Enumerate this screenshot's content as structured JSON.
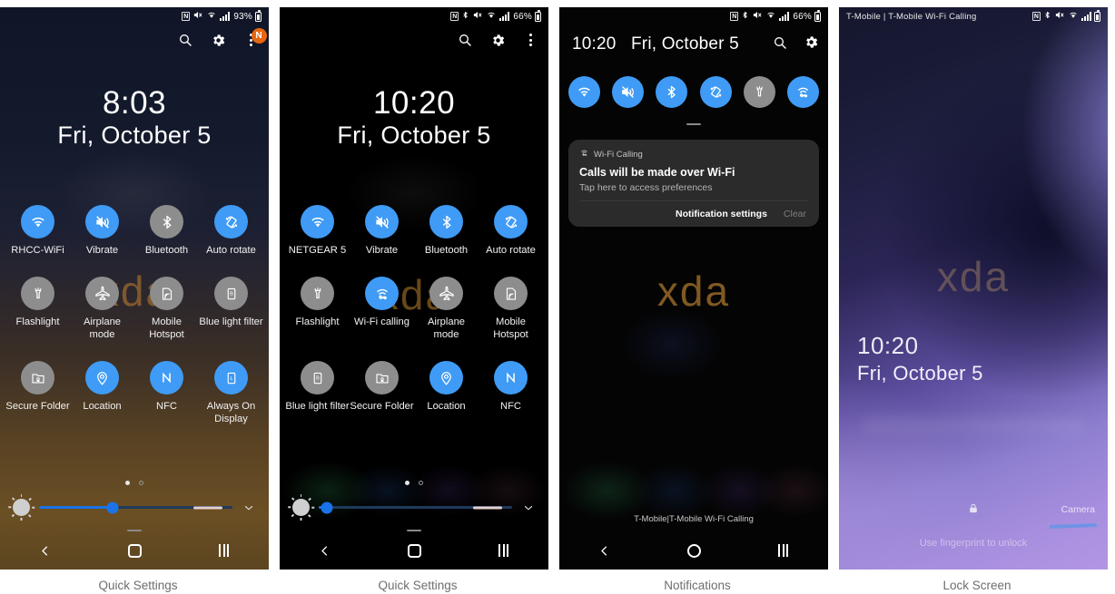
{
  "panels": [
    {
      "caption": "Quick Settings",
      "statusbar": {
        "left": "",
        "battery_pct": "93%",
        "icons": [
          "nfc-icon",
          "mute-icon",
          "wifi-icon",
          "signal-icon"
        ]
      },
      "header": {
        "search": "search-icon",
        "settings": "gear-icon",
        "more": "more-vert-icon",
        "badge": "N"
      },
      "clock": {
        "time": "8:03",
        "date": "Fri, October 5"
      },
      "watermark": "xda",
      "tiles": [
        {
          "label": "RHCC-WiFi",
          "icon": "wifi-icon",
          "state": "on"
        },
        {
          "label": "Vibrate",
          "icon": "vibrate-icon",
          "state": "on"
        },
        {
          "label": "Bluetooth",
          "icon": "bluetooth-icon",
          "state": "off"
        },
        {
          "label": "Auto rotate",
          "icon": "auto-rotate-icon",
          "state": "on"
        },
        {
          "label": "Flashlight",
          "icon": "flashlight-icon",
          "state": "off"
        },
        {
          "label": "Airplane mode",
          "icon": "airplane-icon",
          "state": "off"
        },
        {
          "label": "Mobile Hotspot",
          "icon": "hotspot-icon",
          "state": "off"
        },
        {
          "label": "Blue light filter",
          "icon": "blue-light-icon",
          "state": "off"
        },
        {
          "label": "Secure Folder",
          "icon": "secure-folder-icon",
          "state": "off"
        },
        {
          "label": "Location",
          "icon": "location-icon",
          "state": "on"
        },
        {
          "label": "NFC",
          "icon": "nfc-icon",
          "state": "on"
        },
        {
          "label": "Always On Display",
          "icon": "always-on-display-icon",
          "state": "on"
        }
      ],
      "page_dots": {
        "count": 2,
        "active": 0
      },
      "brightness": {
        "percent": 38
      },
      "navbar": {
        "back": "back-icon",
        "home": "home-icon",
        "recents": "recents-icon"
      }
    },
    {
      "caption": "Quick Settings",
      "statusbar": {
        "left": "",
        "battery_pct": "66%",
        "icons": [
          "nfc-icon",
          "bluetooth-icon",
          "mute-icon",
          "wifi-icon",
          "signal-icon"
        ]
      },
      "header": {
        "search": "search-icon",
        "settings": "gear-icon",
        "more": "more-vert-icon",
        "badge": ""
      },
      "clock": {
        "time": "10:20",
        "date": "Fri, October 5"
      },
      "watermark": "xda",
      "tiles": [
        {
          "label": "NETGEAR 5",
          "icon": "wifi-icon",
          "state": "on"
        },
        {
          "label": "Vibrate",
          "icon": "vibrate-icon",
          "state": "on"
        },
        {
          "label": "Bluetooth",
          "icon": "bluetooth-icon",
          "state": "on"
        },
        {
          "label": "Auto rotate",
          "icon": "auto-rotate-icon",
          "state": "on"
        },
        {
          "label": "Flashlight",
          "icon": "flashlight-icon",
          "state": "off"
        },
        {
          "label": "Wi-Fi calling",
          "icon": "wifi-calling-icon",
          "state": "on"
        },
        {
          "label": "Airplane mode",
          "icon": "airplane-icon",
          "state": "off"
        },
        {
          "label": "Mobile Hotspot",
          "icon": "hotspot-icon",
          "state": "off"
        },
        {
          "label": "Blue light filter",
          "icon": "blue-light-icon",
          "state": "off"
        },
        {
          "label": "Secure Folder",
          "icon": "secure-folder-icon",
          "state": "off"
        },
        {
          "label": "Location",
          "icon": "location-icon",
          "state": "on"
        },
        {
          "label": "NFC",
          "icon": "nfc-icon",
          "state": "on"
        }
      ],
      "page_dots": {
        "count": 2,
        "active": 0
      },
      "brightness": {
        "percent": 9
      },
      "navbar": {
        "back": "back-icon",
        "home": "home-icon",
        "recents": "recents-icon"
      }
    },
    {
      "caption": "Notifications",
      "statusbar": {
        "left": "",
        "battery_pct": "66%",
        "icons": [
          "nfc-icon",
          "bluetooth-icon",
          "mute-icon",
          "wifi-icon",
          "signal-icon"
        ]
      },
      "header": {
        "time": "10:20",
        "date": "Fri, October 5",
        "search": "search-icon",
        "settings": "gear-icon"
      },
      "watermark": "xda",
      "mini_tiles": [
        {
          "icon": "wifi-icon",
          "state": "on"
        },
        {
          "icon": "vibrate-icon",
          "state": "on"
        },
        {
          "icon": "bluetooth-icon",
          "state": "on"
        },
        {
          "icon": "auto-rotate-icon",
          "state": "on"
        },
        {
          "icon": "flashlight-icon",
          "state": "off"
        },
        {
          "icon": "wifi-calling-icon",
          "state": "on"
        }
      ],
      "notification": {
        "app_icon": "wifi-calling-icon",
        "app_name": "Wi-Fi Calling",
        "title": "Calls will be made over Wi-Fi",
        "subtitle": "Tap here to access preferences",
        "action_primary": "Notification settings",
        "action_secondary": "Clear"
      },
      "carrier": "T-Mobile|T-Mobile Wi-Fi Calling",
      "navbar": {
        "back": "back-icon",
        "home": "home-icon",
        "recents": "recents-icon"
      }
    },
    {
      "caption": "Lock Screen",
      "statusbar": {
        "left": "T-Mobile | T-Mobile Wi-Fi Calling",
        "battery_pct": "",
        "icons": [
          "nfc-icon",
          "bluetooth-icon",
          "mute-icon",
          "wifi-icon",
          "signal-icon"
        ]
      },
      "watermark": "xda",
      "clock": {
        "time": "10:20",
        "date": "Fri, October 5"
      },
      "lock_icon": "lock-icon",
      "hint": "Use fingerprint to unlock",
      "camera_label": "Camera"
    }
  ],
  "colors": {
    "accent_on": "#3f9bf5",
    "tile_off": "#8d8d8d",
    "badge": "#e8660f",
    "slider": "#1a73e8",
    "caption": "#6e6e6e"
  }
}
